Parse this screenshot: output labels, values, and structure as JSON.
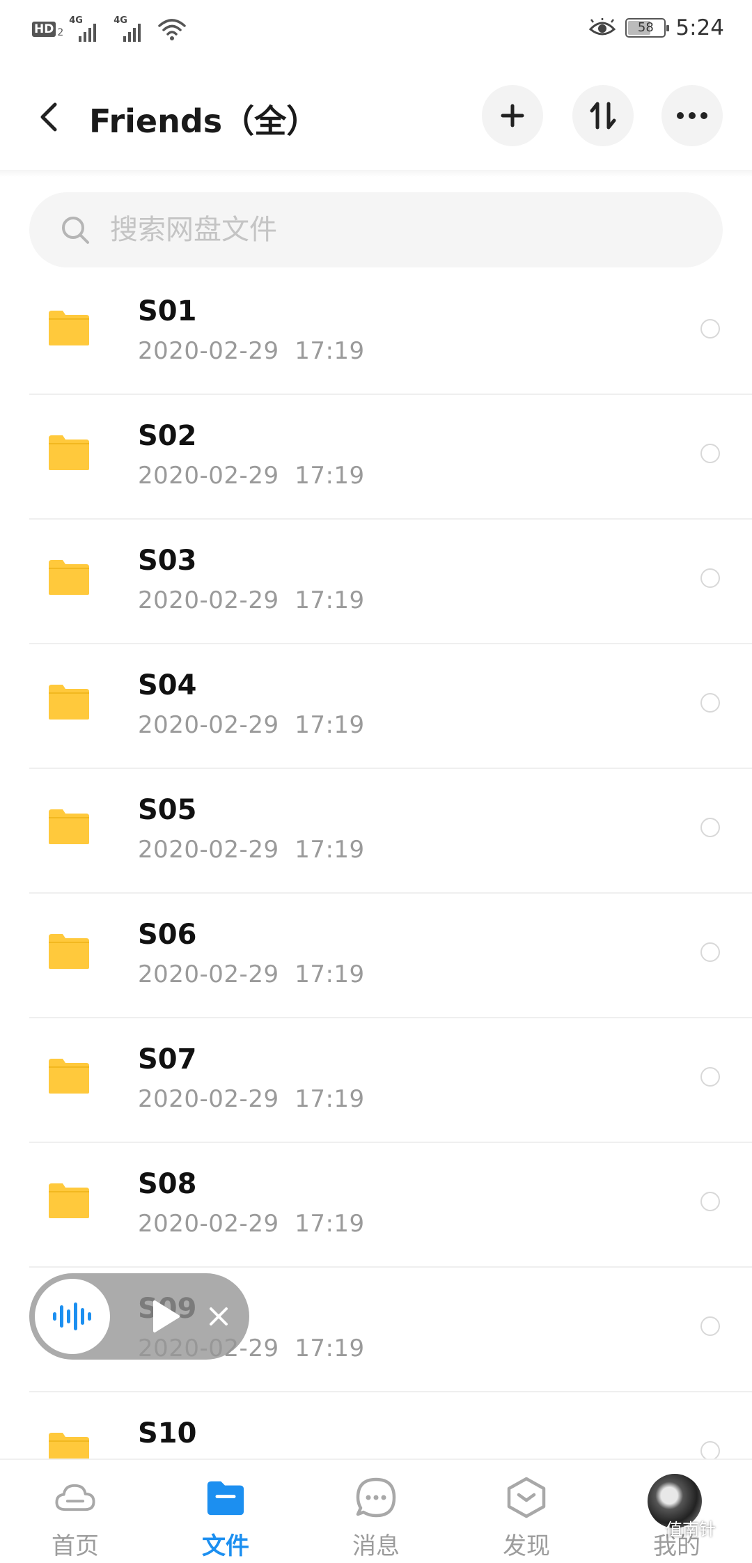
{
  "status_bar": {
    "hd_label": "HD",
    "hd_sub": "2",
    "network_1": "4G",
    "network_2": "4G",
    "battery": "58",
    "time": "5:24"
  },
  "header": {
    "title": "Friends（全）"
  },
  "search": {
    "placeholder": "搜索网盘文件"
  },
  "files": [
    {
      "name": "S01",
      "date": "2020-02-29  17:19"
    },
    {
      "name": "S02",
      "date": "2020-02-29  17:19"
    },
    {
      "name": "S03",
      "date": "2020-02-29  17:19"
    },
    {
      "name": "S04",
      "date": "2020-02-29  17:19"
    },
    {
      "name": "S05",
      "date": "2020-02-29  17:19"
    },
    {
      "name": "S06",
      "date": "2020-02-29  17:19"
    },
    {
      "name": "S07",
      "date": "2020-02-29  17:19"
    },
    {
      "name": "S08",
      "date": "2020-02-29  17:19"
    },
    {
      "name": "S09",
      "date": "2020-02-29  17:19"
    },
    {
      "name": "S10",
      "date": ""
    }
  ],
  "nav": {
    "items": [
      {
        "label": "首页",
        "icon": "cloud-icon"
      },
      {
        "label": "文件",
        "icon": "folder-icon"
      },
      {
        "label": "消息",
        "icon": "message-icon"
      },
      {
        "label": "发现",
        "icon": "discover-icon"
      },
      {
        "label": "我的",
        "icon": "avatar"
      }
    ]
  },
  "watermark": "值南针",
  "colors": {
    "accent": "#1c8ff0",
    "folder": "#ffc93c"
  }
}
